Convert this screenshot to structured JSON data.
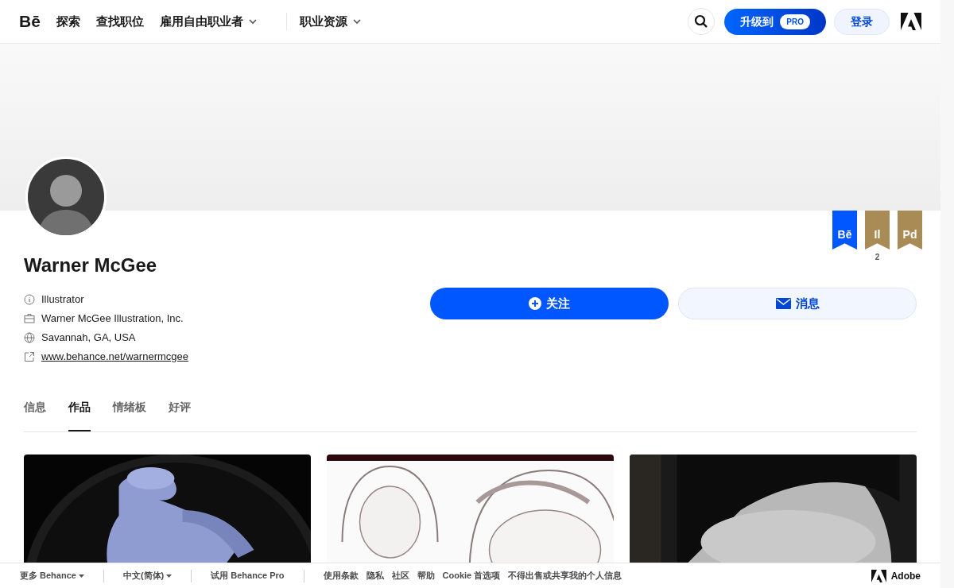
{
  "nav": {
    "logo": "Bē",
    "items": [
      {
        "label": "探索",
        "dropdown": false
      },
      {
        "label": "查找职位",
        "dropdown": false
      },
      {
        "label": "雇用自由职业者",
        "dropdown": true
      },
      {
        "label": "职业资源",
        "dropdown": true
      }
    ],
    "upgrade": {
      "label": "升级到",
      "badge": "PRO"
    },
    "login": "登录"
  },
  "profile": {
    "name": "Warner McGee",
    "details": [
      {
        "kind": "role",
        "text": "Illustrator"
      },
      {
        "kind": "company",
        "text": "Warner McGee Illustration, Inc."
      },
      {
        "kind": "location",
        "text": "Savannah, GA, USA"
      },
      {
        "kind": "link",
        "text": "www.behance.net/warnermcgee"
      }
    ],
    "follow": "关注",
    "message": "消息",
    "badges": [
      {
        "label": "Bē",
        "color": "#0057ff"
      },
      {
        "label": "Il",
        "color": "#a98b56",
        "count": "2"
      },
      {
        "label": "Pd",
        "color": "#a98b56"
      }
    ]
  },
  "tabs": [
    {
      "label": "信息",
      "selected": false
    },
    {
      "label": "作品",
      "selected": true
    },
    {
      "label": "情绪板",
      "selected": false
    },
    {
      "label": "好评",
      "selected": false
    }
  ],
  "footer": {
    "groups": [
      [
        {
          "label": "更多 Behance",
          "dropdown": true
        }
      ],
      [
        {
          "label": "中文(简体)",
          "dropdown": true
        }
      ],
      [
        {
          "label": "试用 Behance Pro",
          "dropdown": false
        }
      ],
      [
        {
          "label": "使用条款",
          "dropdown": false
        },
        {
          "label": "隐私",
          "dropdown": false
        },
        {
          "label": "社区",
          "dropdown": false
        },
        {
          "label": "帮助",
          "dropdown": false
        },
        {
          "label": "Cookie 首选项",
          "dropdown": false
        },
        {
          "label": "不得出售或共享我的个人信息",
          "dropdown": false
        }
      ]
    ],
    "brand": "Adobe"
  }
}
